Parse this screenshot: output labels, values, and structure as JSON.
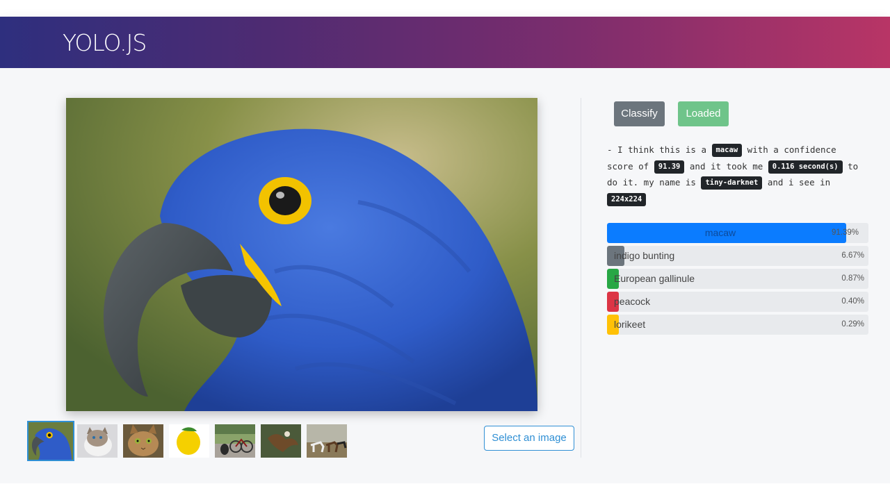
{
  "header": {
    "brand": "YOLO.JS"
  },
  "controls": {
    "classify_label": "Classify",
    "loaded_label": "Loaded",
    "select_image_label": "Select an image"
  },
  "result": {
    "part1": "- I think this is a",
    "label": "macaw",
    "part2": "with a confidence score of",
    "score": "91.39",
    "part3": "and it took me",
    "time": "0.116 second(s)",
    "part4": "to do it. my name is",
    "model": "tiny-darknet",
    "part5": "and i see in",
    "size": "224x224"
  },
  "predictions": [
    {
      "name": "macaw",
      "percent": 91.39,
      "percent_text": "91.39%",
      "color": "#0b7cff"
    },
    {
      "name": "indigo bunting",
      "percent": 6.67,
      "percent_text": "6.67%",
      "color": "#6c757d"
    },
    {
      "name": "European gallinule",
      "percent": 0.87,
      "percent_text": "0.87%",
      "color": "#28a745"
    },
    {
      "name": "peacock",
      "percent": 0.4,
      "percent_text": "0.40%",
      "color": "#dc3545"
    },
    {
      "name": "lorikeet",
      "percent": 0.29,
      "percent_text": "0.29%",
      "color": "#ffc107"
    }
  ],
  "thumbnails": [
    "macaw-thumbnail",
    "cat-thumbnail",
    "tabby-cat-thumbnail",
    "lemon-thumbnail",
    "dog-bicycle-thumbnail",
    "eagle-thumbnail",
    "horses-thumbnail"
  ]
}
